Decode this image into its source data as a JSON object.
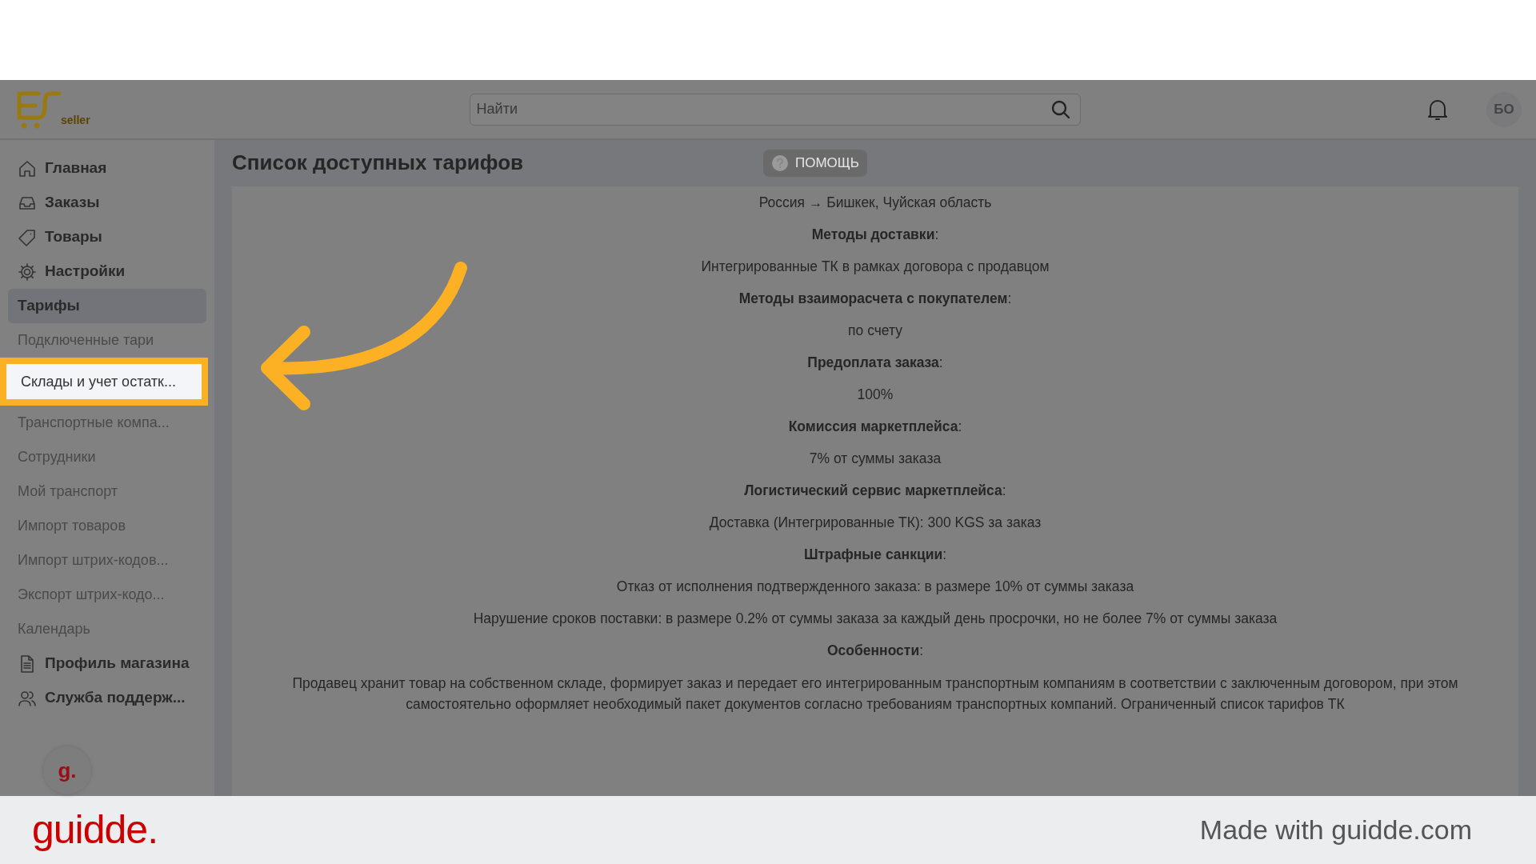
{
  "header": {
    "logo_text": "seller",
    "search": {
      "placeholder": "Найти"
    },
    "avatar": "БО"
  },
  "sidebar": {
    "items": [
      {
        "label": "Главная",
        "kind": "main",
        "selected": false,
        "highlighted": false
      },
      {
        "label": "Заказы",
        "kind": "main",
        "selected": false,
        "highlighted": false
      },
      {
        "label": "Товары",
        "kind": "main",
        "selected": false,
        "highlighted": false
      },
      {
        "label": "Настройки",
        "kind": "main",
        "selected": false,
        "highlighted": false
      },
      {
        "label": "Тарифы",
        "kind": "group",
        "selected": true,
        "highlighted": false
      },
      {
        "label": "Подключенные тари",
        "kind": "sub",
        "selected": false,
        "highlighted": false
      },
      {
        "label": "Склады и учет остатк...",
        "kind": "sub",
        "selected": false,
        "highlighted": true
      },
      {
        "label": "Транспортные компа...",
        "kind": "sub",
        "selected": false,
        "highlighted": false
      },
      {
        "label": "Сотрудники",
        "kind": "sub",
        "selected": false,
        "highlighted": false
      },
      {
        "label": "Мой транспорт",
        "kind": "sub",
        "selected": false,
        "highlighted": false
      },
      {
        "label": "Импорт товаров",
        "kind": "sub",
        "selected": false,
        "highlighted": false
      },
      {
        "label": "Импорт штрих-кодов...",
        "kind": "sub",
        "selected": false,
        "highlighted": false
      },
      {
        "label": "Экспорт штрих-кодо...",
        "kind": "sub",
        "selected": false,
        "highlighted": false
      },
      {
        "label": "Календарь",
        "kind": "sub",
        "selected": false,
        "highlighted": false
      },
      {
        "label": "Профиль магазина",
        "kind": "main",
        "selected": false,
        "highlighted": false
      },
      {
        "label": "Служба поддерж...",
        "kind": "main",
        "selected": false,
        "highlighted": false
      }
    ],
    "guidde_bubble": "g."
  },
  "page": {
    "title": "Список доступных тарифов",
    "help_button": "ПОМОЩЬ",
    "lines": [
      {
        "kind": "text",
        "text": "Россия → Бишкек, Чуйская область"
      },
      {
        "kind": "label",
        "text": "**Методы доставки**:"
      },
      {
        "kind": "text",
        "text": "Интегрированные ТК в рамках договора с продавцом"
      },
      {
        "kind": "label",
        "text": "**Методы  взаиморасчета с покупателем**:"
      },
      {
        "kind": "text",
        "text": "по счету"
      },
      {
        "kind": "label",
        "text": "**Предоплата заказа**:"
      },
      {
        "kind": "text",
        "text": "100%"
      },
      {
        "kind": "label",
        "text": "**Комиссия маркетплейса**:"
      },
      {
        "kind": "text",
        "text": "7% от суммы заказа"
      },
      {
        "kind": "label",
        "text": "**Логистический сервис маркетплейса**:"
      },
      {
        "kind": "text",
        "text": "Доставка (Интегрированные ТК): 300 KGS за заказ"
      },
      {
        "kind": "label",
        "text": "**Штрафные санкции**:"
      },
      {
        "kind": "text",
        "text": "Отказ от исполнения подтвержденного заказа: в размере 10% от суммы заказа"
      },
      {
        "kind": "text",
        "text": "Нарушение сроков поставки: в размере 0.2% от суммы заказа за каждый день просрочки, но не более 7% от суммы заказа"
      },
      {
        "kind": "label",
        "text": "**Особенности**:"
      },
      {
        "kind": "paragraph",
        "text": "Продавец хранит товар на собственном складе, формирует заказ и передает его интегрированным транспортным компаниям в соответствии с заключенным договором, при этом самостоятельно оформляет необходимый пакет документов согласно требованиям транспортных компаний. Ограниченный список тарифов ТК"
      }
    ]
  },
  "footer": {
    "brand": "guidde.",
    "credit": "Made with guidde.com"
  }
}
